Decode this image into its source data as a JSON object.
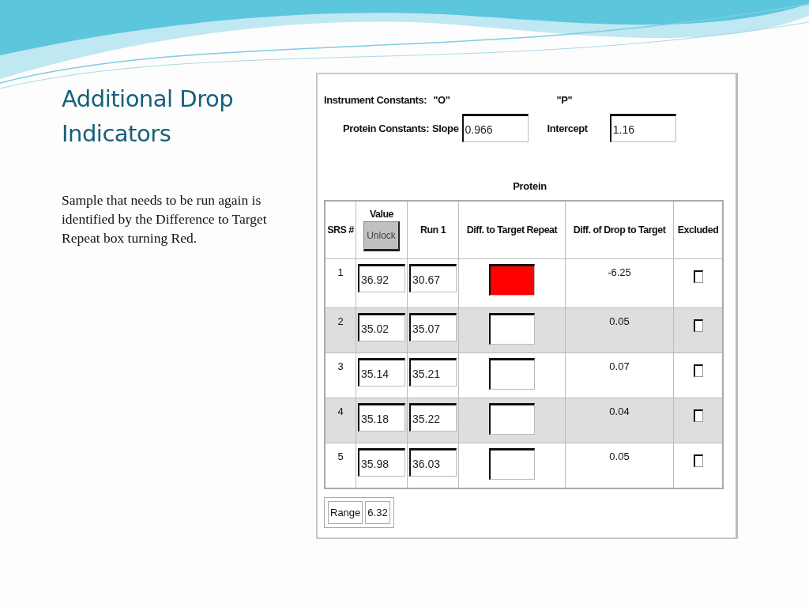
{
  "slide": {
    "title": "Additional Drop Indicators",
    "body": "Sample that needs to be run again is identified by the Difference to Target Repeat box turning Red."
  },
  "form": {
    "instrument_label": "Instrument Constants:",
    "instrument_o": "\"O\"",
    "instrument_p": "\"P\"",
    "protein_label": "Protein Constants:",
    "slope_label": "Slope",
    "slope_value": "0.966",
    "intercept_label": "Intercept",
    "intercept_value": "1.16",
    "table_title": "Protein",
    "columns": [
      "SRS #",
      "Value",
      "Run 1",
      "Diff. to Target Repeat",
      "Diff. of Drop to Target",
      "Excluded"
    ],
    "unlock_button": "Unlock",
    "rows": [
      {
        "srs": "1",
        "value": "36.92",
        "run1": "30.67",
        "flagged": true,
        "diff_drop": "-6.25",
        "excluded": false
      },
      {
        "srs": "2",
        "value": "35.02",
        "run1": "35.07",
        "flagged": false,
        "diff_drop": "0.05",
        "excluded": false
      },
      {
        "srs": "3",
        "value": "35.14",
        "run1": "35.21",
        "flagged": false,
        "diff_drop": "0.07",
        "excluded": false
      },
      {
        "srs": "4",
        "value": "35.18",
        "run1": "35.22",
        "flagged": false,
        "diff_drop": "0.04",
        "excluded": false
      },
      {
        "srs": "5",
        "value": "35.98",
        "run1": "36.03",
        "flagged": false,
        "diff_drop": "0.05",
        "excluded": false
      }
    ],
    "range_label": "Range",
    "range_value": "6.32"
  }
}
